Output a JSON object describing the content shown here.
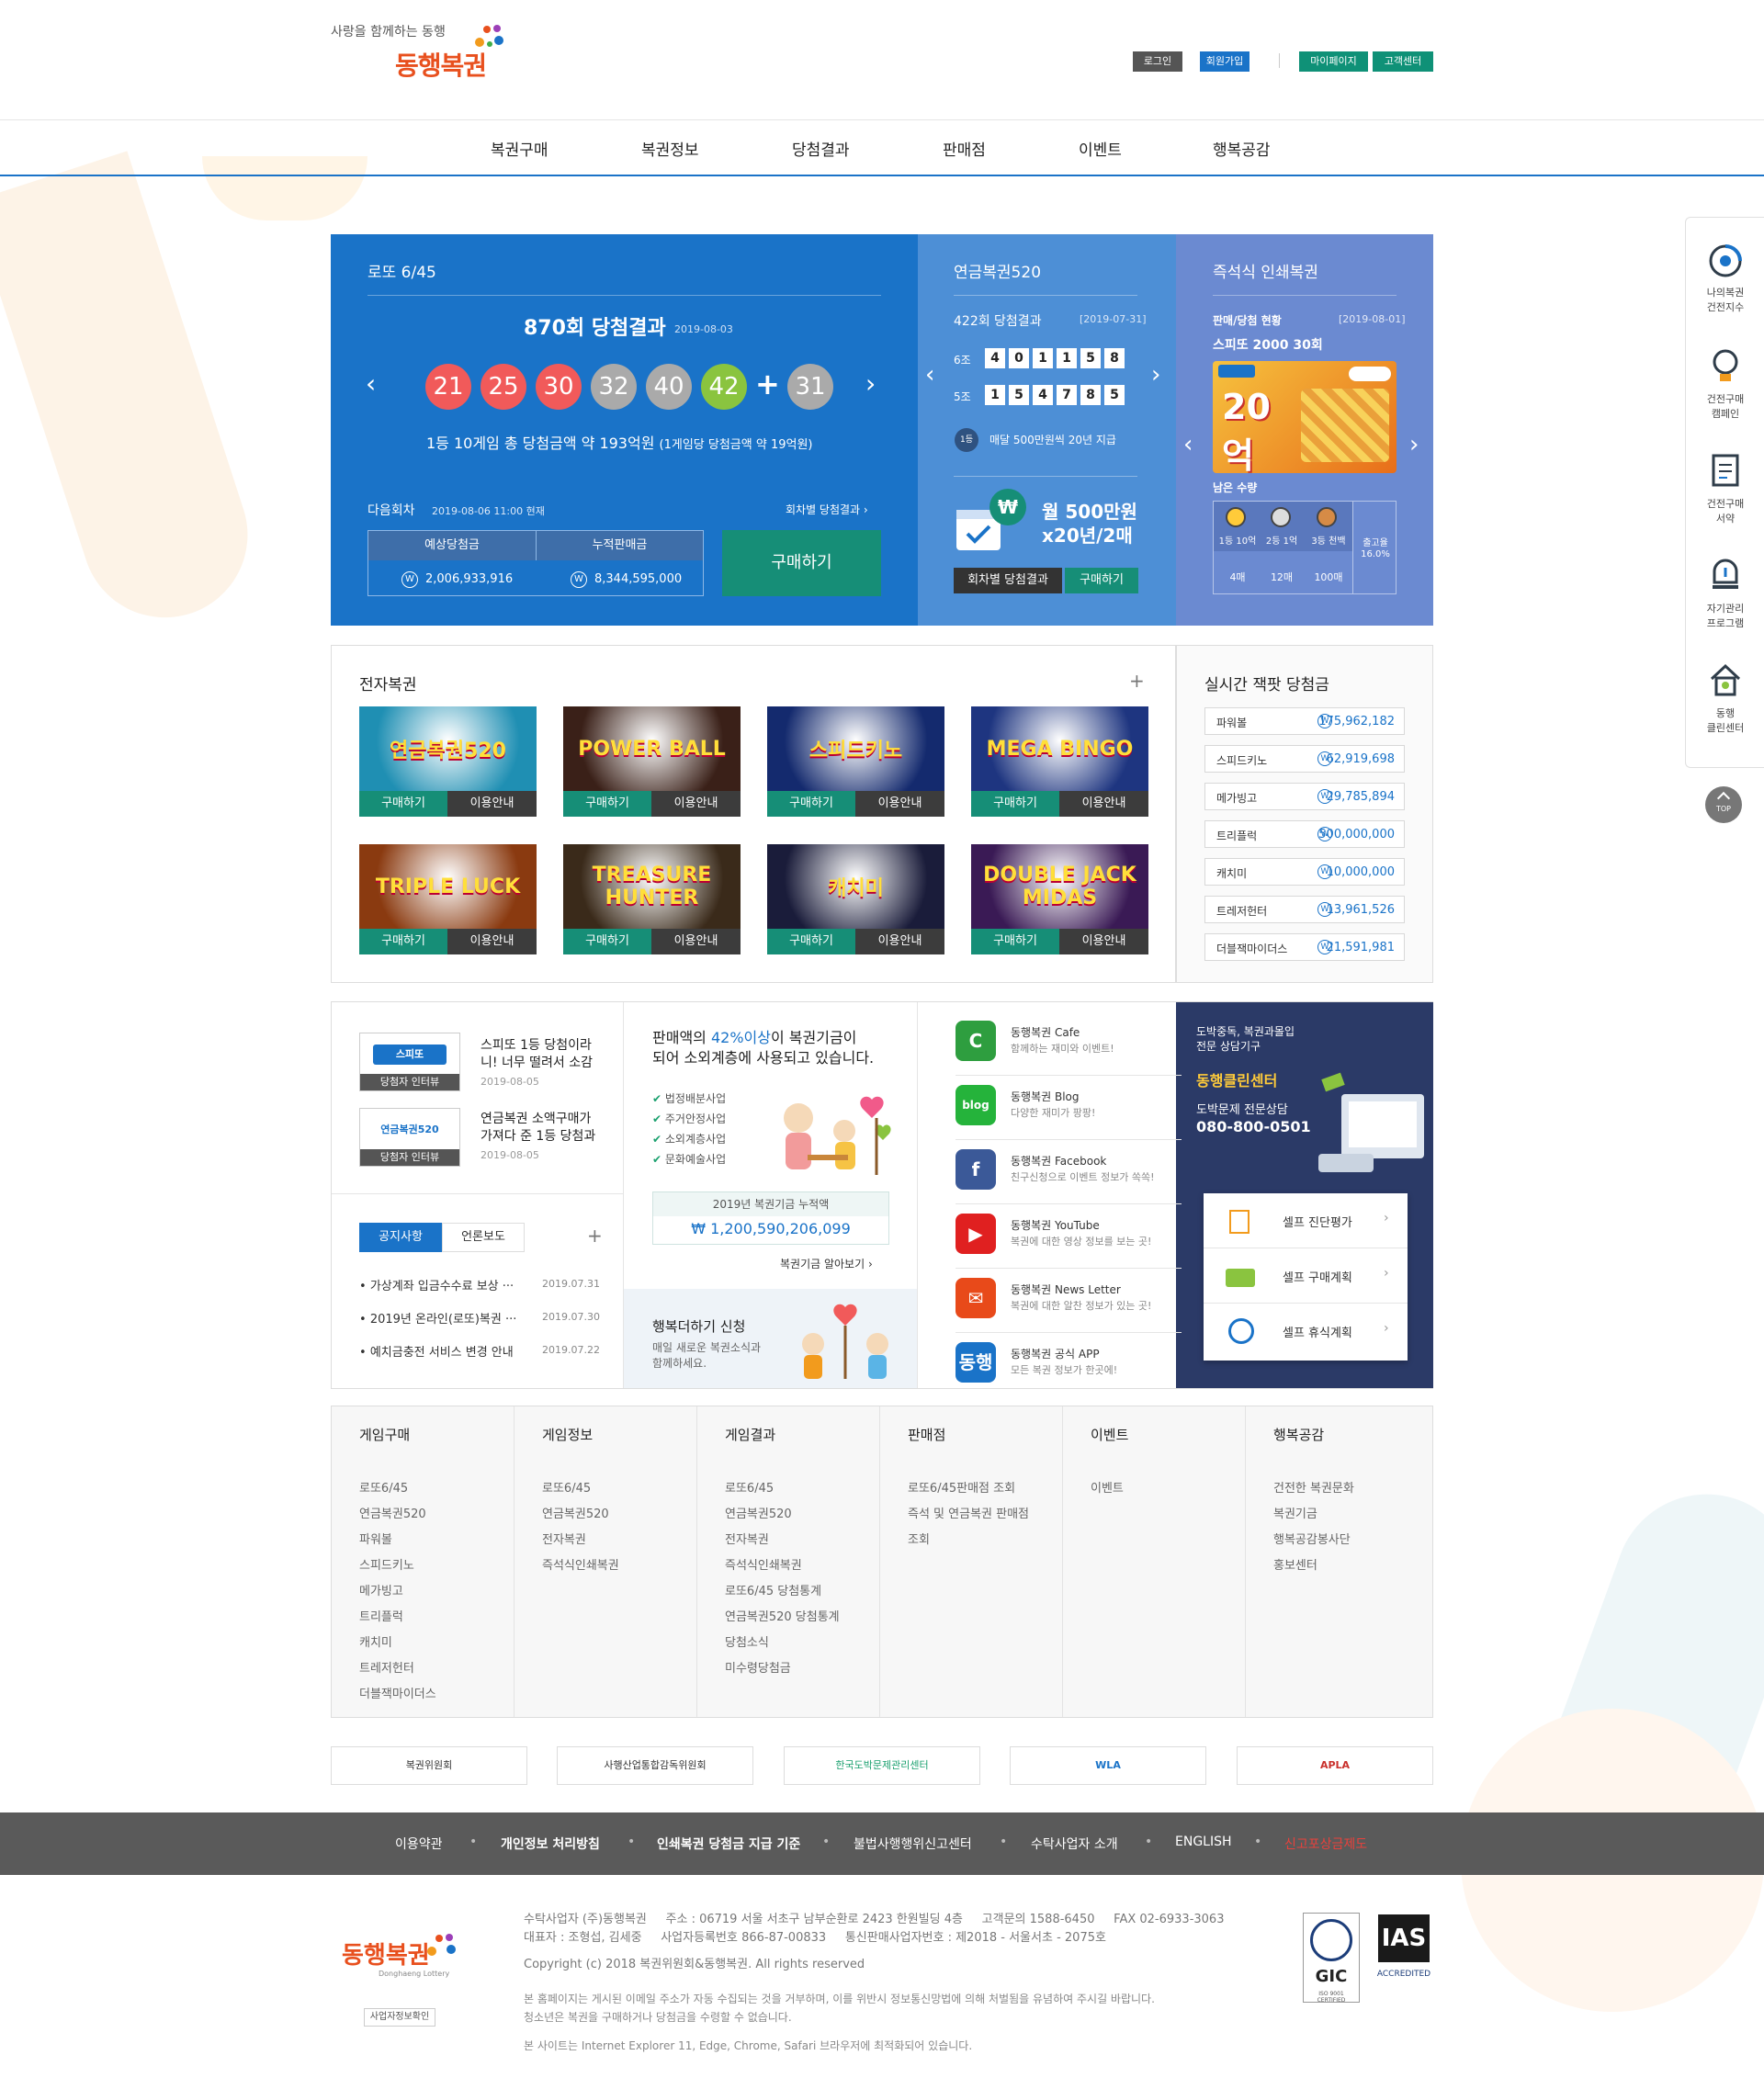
{
  "header": {
    "slogan": "사랑을 함께하는 동행",
    "logo": "동행복권",
    "top_buttons": [
      "로그인",
      "회원가입",
      "마이페이지",
      "고객센터"
    ],
    "nav": [
      "복권구매",
      "복권정보",
      "당첨결과",
      "판매점",
      "이벤트",
      "행복공감"
    ]
  },
  "lotto": {
    "title": "로또 6/45",
    "round_title": "870회 당첨결과",
    "round_date": "2019-08-03",
    "numbers": [
      "21",
      "25",
      "30",
      "32",
      "40",
      "42"
    ],
    "plus": "+",
    "bonus": "31",
    "summary": "1등 10게임 총 당첨금액 약 193억원",
    "summary_sub": "(1게임당 당첨금액 약 19억원)",
    "next_label": "다음회차",
    "next_time": "2019-08-06 11:00 현재",
    "history_link": "회차별 당첨결과",
    "est_label": "예상당첨금",
    "sales_label": "누적판매금",
    "est_value": "2,006,933,916",
    "sales_value": "8,344,595,000",
    "buy_button": "구매하기",
    "won_mark": "W"
  },
  "pension": {
    "title": "연금복권520",
    "round_title": "422회 당첨결과",
    "round_date": "[2019-07-31]",
    "row1_label": "6조",
    "row1_digits": [
      "4",
      "0",
      "1",
      "1",
      "5",
      "8"
    ],
    "row2_label": "5조",
    "row2_digits": [
      "1",
      "5",
      "4",
      "7",
      "8",
      "5"
    ],
    "first_badge": "1등",
    "first_desc": "매달 500만원씩 20년 지급",
    "promo_line1": "월 500만원",
    "promo_line2": "x20년/2매",
    "promo_won": "₩",
    "history_button": "회차별 당첨결과",
    "buy_button": "구매하기"
  },
  "instant": {
    "title": "즉석식 인쇄복권",
    "status_label": "판매/당첨 현황",
    "status_date": "[2019-08-01]",
    "game_name": "스피또 2000 30회",
    "ticket_text": "20억",
    "remain_label": "남은 수량",
    "prizes": [
      {
        "rank": "1등 10억",
        "count": "4매"
      },
      {
        "rank": "2등 1억",
        "count": "12매"
      },
      {
        "rank": "3등 천백",
        "count": "100매"
      }
    ],
    "release_label": "출고율",
    "release_rate": "16.0%"
  },
  "elottery": {
    "title": "전자복권",
    "more": "+",
    "buy_label": "구매하기",
    "info_label": "이용안내",
    "games": [
      {
        "name": "연금복권520",
        "color": "#1f8fb3"
      },
      {
        "name": "POWER BALL",
        "color": "#3a2018"
      },
      {
        "name": "스피드키노",
        "color": "#142a6e"
      },
      {
        "name": "MEGA BINGO",
        "color": "#1e3580"
      },
      {
        "name": "TRIPLE LUCK",
        "color": "#8a3a10"
      },
      {
        "name": "TREASURE HUNTER",
        "color": "#3a2a1a"
      },
      {
        "name": "캐치미",
        "color": "#1a1c3a"
      },
      {
        "name": "DOUBLE JACK MIDAS",
        "color": "#3a1a55"
      }
    ]
  },
  "jackpot": {
    "title": "실시간 잭팟 당첨금",
    "won": "W",
    "rows": [
      {
        "name": "파워볼",
        "value": "175,962,182"
      },
      {
        "name": "스피드키노",
        "value": "62,919,698"
      },
      {
        "name": "메가빙고",
        "value": "29,785,894"
      },
      {
        "name": "트리플럭",
        "value": "500,000,000"
      },
      {
        "name": "캐치미",
        "value": "10,000,000"
      },
      {
        "name": "트레저헌터",
        "value": "13,961,526"
      },
      {
        "name": "더블잭마이더스",
        "value": "21,591,981"
      }
    ]
  },
  "interviews": [
    {
      "badge": "스피또",
      "tag": "당첨자 인터뷰",
      "title1": "스피또 1등 당첨이라",
      "title2": "니! 너무 떨려서 소감",
      "date": "2019-08-05"
    },
    {
      "badge": "연금복권520",
      "tag": "당첨자 인터뷰",
      "title1": "연금복권 소액구매가",
      "title2": "가져다 준 1등 당첨과",
      "date": "2019-08-05"
    }
  ],
  "notice": {
    "tabs": [
      "공지사항",
      "언론보도"
    ],
    "more": "+",
    "items": [
      {
        "title": "가상계좌 입금수수료 보상 ···",
        "date": "2019.07.31"
      },
      {
        "title": "2019년 온라인(로또)복권 ···",
        "date": "2019.07.30"
      },
      {
        "title": "예치금충전 서비스 변경 안내",
        "date": "2019.07.22"
      }
    ]
  },
  "fund": {
    "head_pre": "판매액의 ",
    "head_highlight": "42%이상",
    "head_post": "이 복권기금이",
    "head_line2": "되어 소외계층에 사용되고 있습니다.",
    "uses": [
      "법정배분사업",
      "주거안정사업",
      "소외계층사업",
      "문화예술사업"
    ],
    "total_label": "2019년 복권기금 누적액",
    "total_value": "₩ 1,200,590,206,099",
    "link": "복권기금 알아보기",
    "happy_title": "행복더하기 신청",
    "happy_desc1": "매일 새로운 복권소식과",
    "happy_desc2": "함께하세요."
  },
  "social": [
    {
      "name": "동행복권 Cafe",
      "desc": "함께하는 재미와 이벤트!",
      "icon": "C",
      "color": "#2e9e3f"
    },
    {
      "name": "동행복권 Blog",
      "desc": "다양한 재미가 팡팡!",
      "icon": "blog",
      "color": "#25b33b"
    },
    {
      "name": "동행복권 Facebook",
      "desc": "친구신청으로 이벤트 정보가 쏙쏙!",
      "icon": "f",
      "color": "#3b5998"
    },
    {
      "name": "동행복권 YouTube",
      "desc": "복권에 대한 영상 정보를 보는 곳!",
      "icon": "▶",
      "color": "#e02020"
    },
    {
      "name": "동행복권 News Letter",
      "desc": "복권에 대한 알찬 정보가 있는 곳!",
      "icon": "✉",
      "color": "#e84a1a"
    },
    {
      "name": "동행복권 공식 APP",
      "desc": "모든 복권 정보가 한곳에!",
      "icon": "동행",
      "color": "#1a73c8"
    }
  ],
  "clean": {
    "line1": "도박중독, 복권과몰입",
    "line2": "전문 상담기구",
    "center": "동행클린센터",
    "counsel": "도박문제 전문상담",
    "phone": "080-800-0501",
    "self": [
      "셀프 진단평가",
      "셀프 구매계획",
      "셀프 휴식계획"
    ]
  },
  "sitemap": [
    {
      "title": "게임구매",
      "items": [
        "로또6/45",
        "연금복권520",
        "파워볼",
        "스피드키노",
        "메가빙고",
        "트리플럭",
        "캐치미",
        "트레저헌터",
        "더블잭마이더스"
      ]
    },
    {
      "title": "게임정보",
      "items": [
        "로또6/45",
        "연금복권520",
        "전자복권",
        "즉석식인쇄복권"
      ]
    },
    {
      "title": "게임결과",
      "items": [
        "로또6/45",
        "연금복권520",
        "전자복권",
        "즉석식인쇄복권",
        "로또6/45 당첨통계",
        "연금복권520 당첨통계",
        "당첨소식",
        "미수령당첨금"
      ]
    },
    {
      "title": "판매점",
      "items": [
        "로또6/45판매점 조회",
        "즉석 및 연금복권 판매점",
        "조회"
      ]
    },
    {
      "title": "이벤트",
      "items": [
        "이벤트"
      ]
    },
    {
      "title": "행복공감",
      "items": [
        "건전한 복권문화",
        "복권기금",
        "행복공감봉사단",
        "홍보센터"
      ]
    }
  ],
  "partners": [
    "복권위원회",
    "사행산업통합감독위원회",
    "한국도박문제관리센터",
    "WLA",
    "APLA"
  ],
  "footer_links": [
    "이용약관",
    "개인정보 처리방침",
    "인쇄복권 당첨금 지급 기준",
    "불법사행행위신고센터",
    "수탁사업자 소개",
    "ENGLISH",
    "신고포상금제도"
  ],
  "footer": {
    "line1": "수탁사업자 (주)동행복권     주소 : 06719 서울 서초구 남부순환로 2423 한원빌딩 4층     고객문의 1588-6450     FAX 02-6933-3063",
    "line2": "대표자 : 조형섭, 김세중     사업자등록번호 866-87-00833     통신판매사업자번호 : 제2018 - 서울서초 - 2075호",
    "copyright": "Copyright (c) 2018 복권위원회&동행복권. All rights reserved",
    "notice1": "본 홈페이지는 게시된 이메일 주소가 자동 수집되는 것을 거부하며, 이를 위반시 정보통신망법에 의해 처벌됨을 유념하여 주시길 바랍니다.",
    "notice2": "청소년은 복권을 구매하거나 당첨금을 수령할 수 없습니다.",
    "notice3": "본 사이트는 Internet Explorer 11, Edge, Chrome, Safari 브라우저에 최적화되어 있습니다.",
    "logo": "동행복권",
    "logo_sub": "Donghaeng Lottery",
    "biz_button": "사업자정보확인",
    "cert1": "GIC",
    "cert1_sub": "ISO 9001 CERTIFIED",
    "cert2": "IAS",
    "cert2_sub": "ACCREDITED"
  },
  "quick_menu": [
    {
      "label": "나의복권\n건전지수",
      "icon": "gauge-icon"
    },
    {
      "label": "건전구매\n캠페인",
      "icon": "bulb-icon"
    },
    {
      "label": "건전구매\n서약",
      "icon": "document-icon"
    },
    {
      "label": "자기관리\n프로그램",
      "icon": "alert-icon"
    },
    {
      "label": "동행\n클린센터",
      "icon": "house-icon"
    }
  ],
  "top_button": "TOP",
  "colors": {
    "primary": "#1a73c8",
    "green": "#168e77",
    "dark": "#3c3c3c"
  }
}
